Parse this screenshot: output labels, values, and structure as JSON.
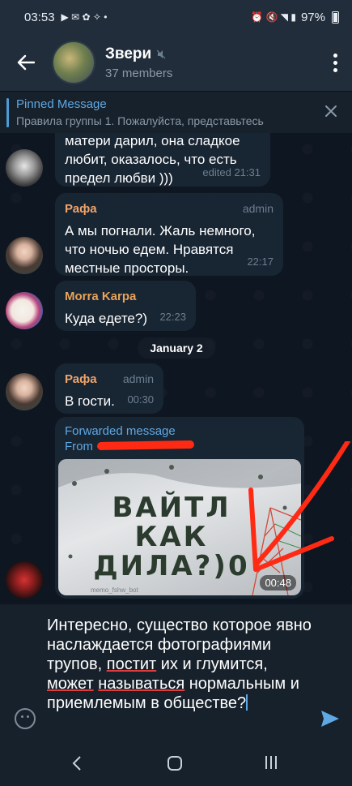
{
  "status_bar": {
    "time": "03:53",
    "battery": "97%"
  },
  "header": {
    "title": "Звери",
    "subtitle": "37 members"
  },
  "pinned": {
    "title": "Pinned Message",
    "text": "Правила группы  1. Пожалуйста, представьтесь"
  },
  "messages": [
    {
      "text": "матери дарил, она сладкое любит, оказалось, что есть предел любви )))",
      "meta": "edited 21:31"
    },
    {
      "name": "Рафа",
      "role": "admin",
      "text": "А мы погнали. Жаль немного, что ночью едем. Нравятся местные просторы.",
      "time": "22:17"
    },
    {
      "name": "Morra Karpa",
      "text": "Куда едете?)",
      "time": "22:23"
    },
    {
      "name": "Рафа",
      "role": "admin",
      "text": "В гости.",
      "time": "00:30"
    }
  ],
  "date_separator": "January 2",
  "forwarded": {
    "label": "Forwarded message",
    "from_prefix": "From",
    "media_caption": "ВАЙТЛ КАК ДИЛА?)0",
    "duration": "00:48",
    "watermark": "memo_fshw_bot"
  },
  "composer": {
    "parts": [
      "Интересно, существо которое явно наслаждается фотографиями трупов, ",
      "постит",
      " их и глумится, ",
      "может",
      " ",
      "называться",
      " нормальным и приемлемым в обществе?"
    ]
  },
  "colors": {
    "header_bg": "#212d3b",
    "chat_bg": "#0e1621",
    "bubble_bg": "#182533",
    "accent": "#5ea8e4",
    "rafa_name": "#f0a46a",
    "morra_name": "#e8a35a",
    "annotation": "#ff2a14"
  },
  "icons": [
    "back-arrow-icon",
    "muted-icon",
    "more-vert-icon",
    "close-icon",
    "emoji-icon",
    "send-icon",
    "nav-back-icon",
    "nav-home-icon",
    "nav-recents-icon"
  ]
}
